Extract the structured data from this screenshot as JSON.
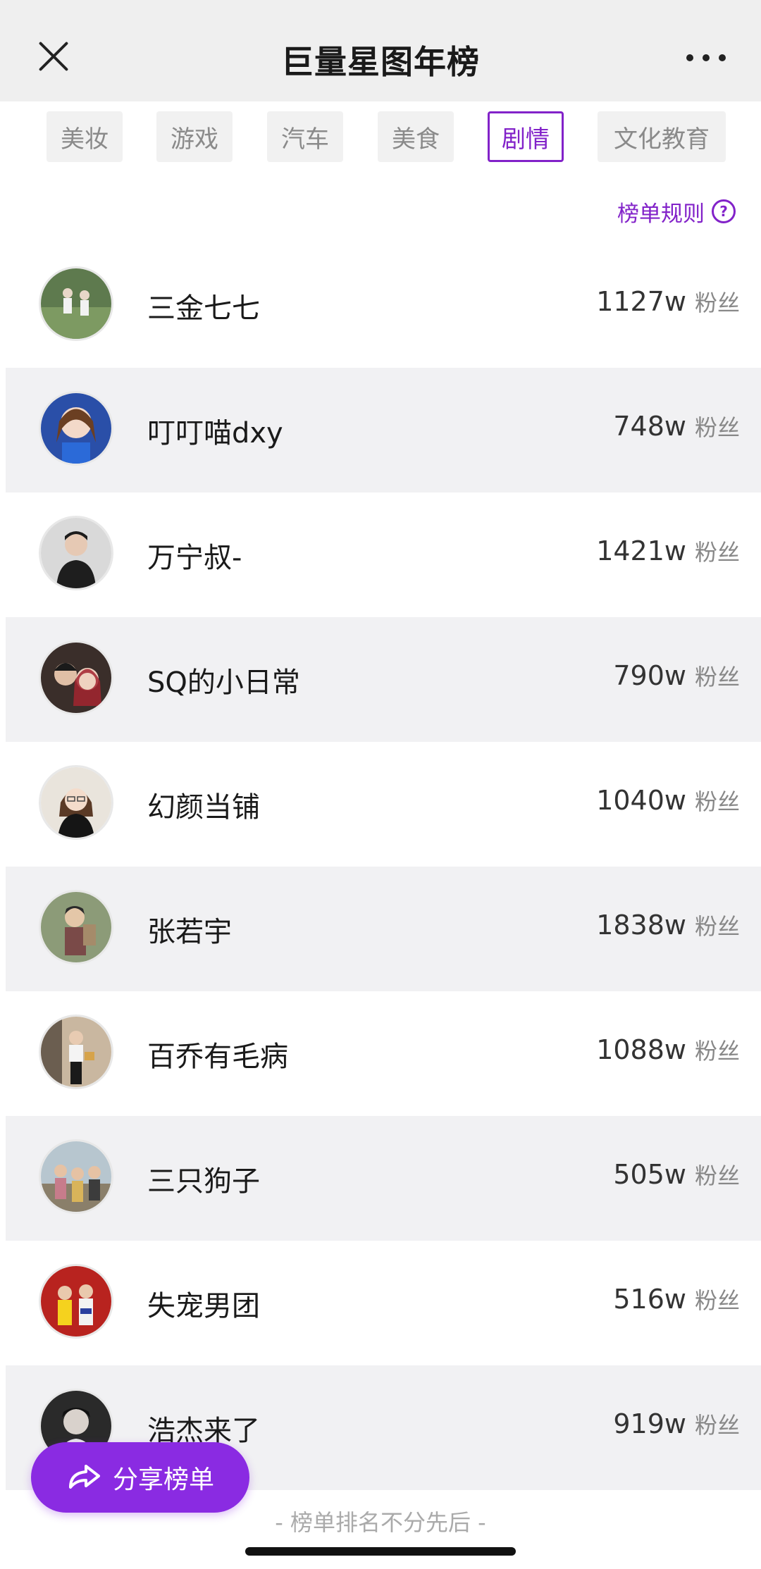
{
  "header": {
    "title": "巨量星图年榜",
    "close_icon": "close-icon",
    "more_icon": "more-horizontal-icon"
  },
  "tabs": [
    {
      "label": "美妆",
      "active": false
    },
    {
      "label": "游戏",
      "active": false
    },
    {
      "label": "汽车",
      "active": false
    },
    {
      "label": "美食",
      "active": false
    },
    {
      "label": "剧情",
      "active": true
    },
    {
      "label": "文化教育",
      "active": false
    }
  ],
  "rules": {
    "label": "榜单规则",
    "icon": "help-circle-icon"
  },
  "colors": {
    "accent": "#8222c9",
    "row_alt": "#f1f1f3",
    "header_bg": "#efefef"
  },
  "creators": [
    {
      "name": "三金七七",
      "fans": "1127w",
      "unit": "粉丝"
    },
    {
      "name": "叮叮喵dxy",
      "fans": "748w",
      "unit": "粉丝"
    },
    {
      "name": "万宁叔-",
      "fans": "1421w",
      "unit": "粉丝"
    },
    {
      "name": "SQ的小日常",
      "fans": "790w",
      "unit": "粉丝"
    },
    {
      "name": "幻颜当铺",
      "fans": "1040w",
      "unit": "粉丝"
    },
    {
      "name": "张若宇",
      "fans": "1838w",
      "unit": "粉丝"
    },
    {
      "name": "百乔有毛病",
      "fans": "1088w",
      "unit": "粉丝"
    },
    {
      "name": "三只狗子",
      "fans": "505w",
      "unit": "粉丝"
    },
    {
      "name": "失宠男团",
      "fans": "516w",
      "unit": "粉丝"
    },
    {
      "name": "浩杰来了",
      "fans": "919w",
      "unit": "粉丝"
    }
  ],
  "share": {
    "label": "分享榜单",
    "icon": "share-icon"
  },
  "footer": {
    "note": "- 榜单排名不分先后 -"
  }
}
